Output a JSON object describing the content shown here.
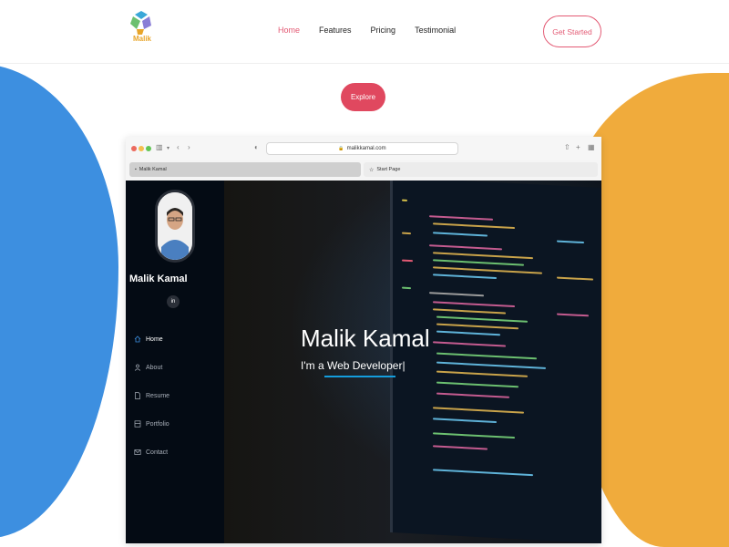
{
  "brand": {
    "logo_text": "Malik"
  },
  "nav": {
    "links": [
      {
        "label": "Home",
        "active": true
      },
      {
        "label": "Features",
        "active": false
      },
      {
        "label": "Pricing",
        "active": false
      },
      {
        "label": "Testimonial",
        "active": false
      }
    ],
    "cta_label": "Get Started"
  },
  "hero": {
    "explore_label": "Explore"
  },
  "browser": {
    "url": "malikkamal.com",
    "tabs": [
      {
        "label": "Malik Kamal",
        "icon": "page-icon"
      },
      {
        "label": "Start Page",
        "icon": "star-icon"
      }
    ]
  },
  "site": {
    "profile_name": "Malik Kamal",
    "social": "in",
    "menu": [
      {
        "label": "Home",
        "icon": "home-icon",
        "active": true
      },
      {
        "label": "About",
        "icon": "person-icon",
        "active": false
      },
      {
        "label": "Resume",
        "icon": "file-icon",
        "active": false
      },
      {
        "label": "Portfolio",
        "icon": "portfolio-icon",
        "active": false
      },
      {
        "label": "Contact",
        "icon": "envelope-icon",
        "active": false
      }
    ],
    "hero_title": "Malik Kamal",
    "hero_subtitle": "I'm a Web Developer|"
  },
  "colors": {
    "accent_pink": "#e35a74",
    "explore_red": "#e0485f",
    "blob_blue": "#3d8fe0",
    "blob_orange": "#f0ab3c",
    "site_accent": "#149ddd"
  }
}
